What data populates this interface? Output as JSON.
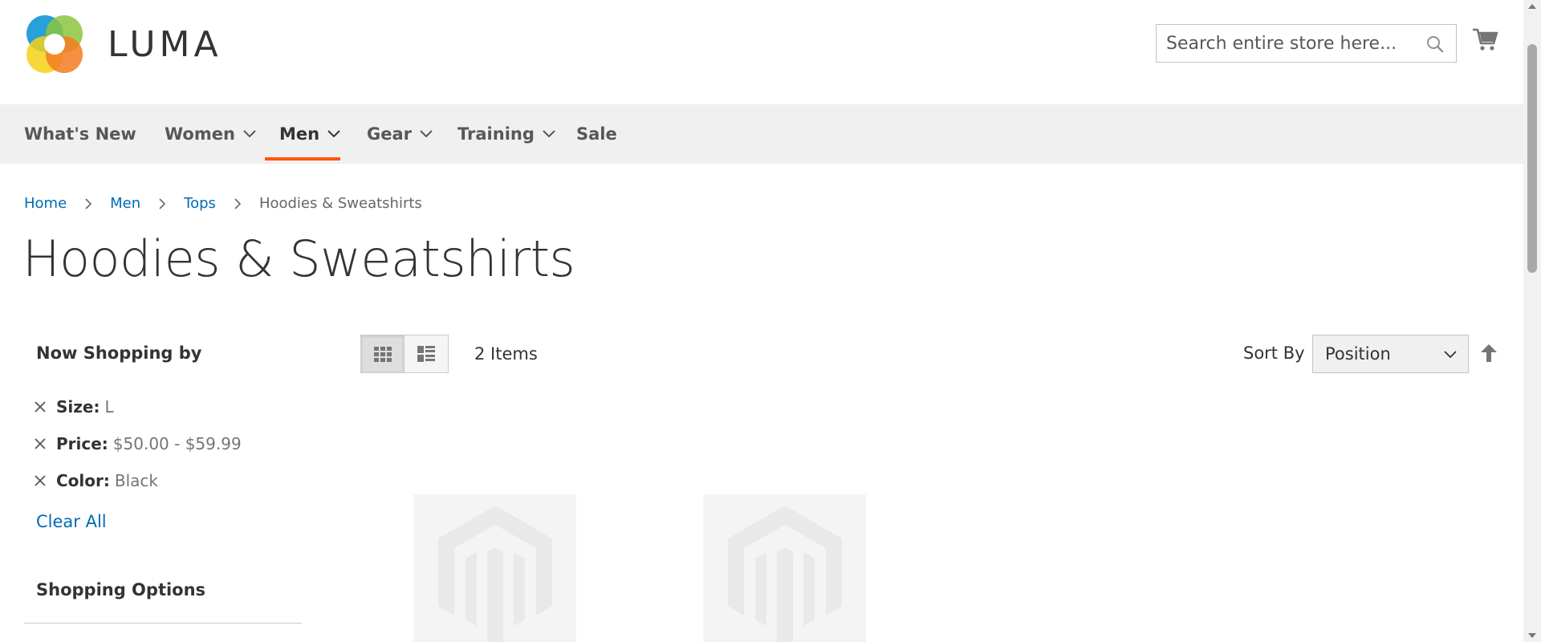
{
  "brand": {
    "name": "LUMA"
  },
  "search": {
    "placeholder": "Search entire store here..."
  },
  "nav": {
    "items": [
      {
        "label": "What's New",
        "has_dropdown": false,
        "active": false
      },
      {
        "label": "Women",
        "has_dropdown": true,
        "active": false
      },
      {
        "label": "Men",
        "has_dropdown": true,
        "active": true
      },
      {
        "label": "Gear",
        "has_dropdown": true,
        "active": false
      },
      {
        "label": "Training",
        "has_dropdown": true,
        "active": false
      },
      {
        "label": "Sale",
        "has_dropdown": false,
        "active": false
      }
    ],
    "active_accent": "#ff5501"
  },
  "breadcrumb": {
    "links": [
      "Home",
      "Men",
      "Tops"
    ],
    "current": "Hoodies & Sweatshirts"
  },
  "page": {
    "title": "Hoodies & Sweatshirts"
  },
  "sidebar": {
    "now_shopping_title": "Now Shopping by",
    "filters": [
      {
        "label": "Size:",
        "value": "L"
      },
      {
        "label": "Price:",
        "value": "$50.00 - $59.99"
      },
      {
        "label": "Color:",
        "value": "Black"
      }
    ],
    "clear_all": "Clear All",
    "shopping_options_title": "Shopping Options"
  },
  "toolbar": {
    "view_modes": [
      "grid",
      "list"
    ],
    "active_view": "grid",
    "items_count": "2 Items",
    "sort_label": "Sort By",
    "sort_value": "Position"
  },
  "products": [
    {
      "image": "placeholder"
    },
    {
      "image": "placeholder"
    }
  ],
  "colors": {
    "link": "#006bb4",
    "nav_bg": "#f0f0f0",
    "text": "#333333"
  }
}
